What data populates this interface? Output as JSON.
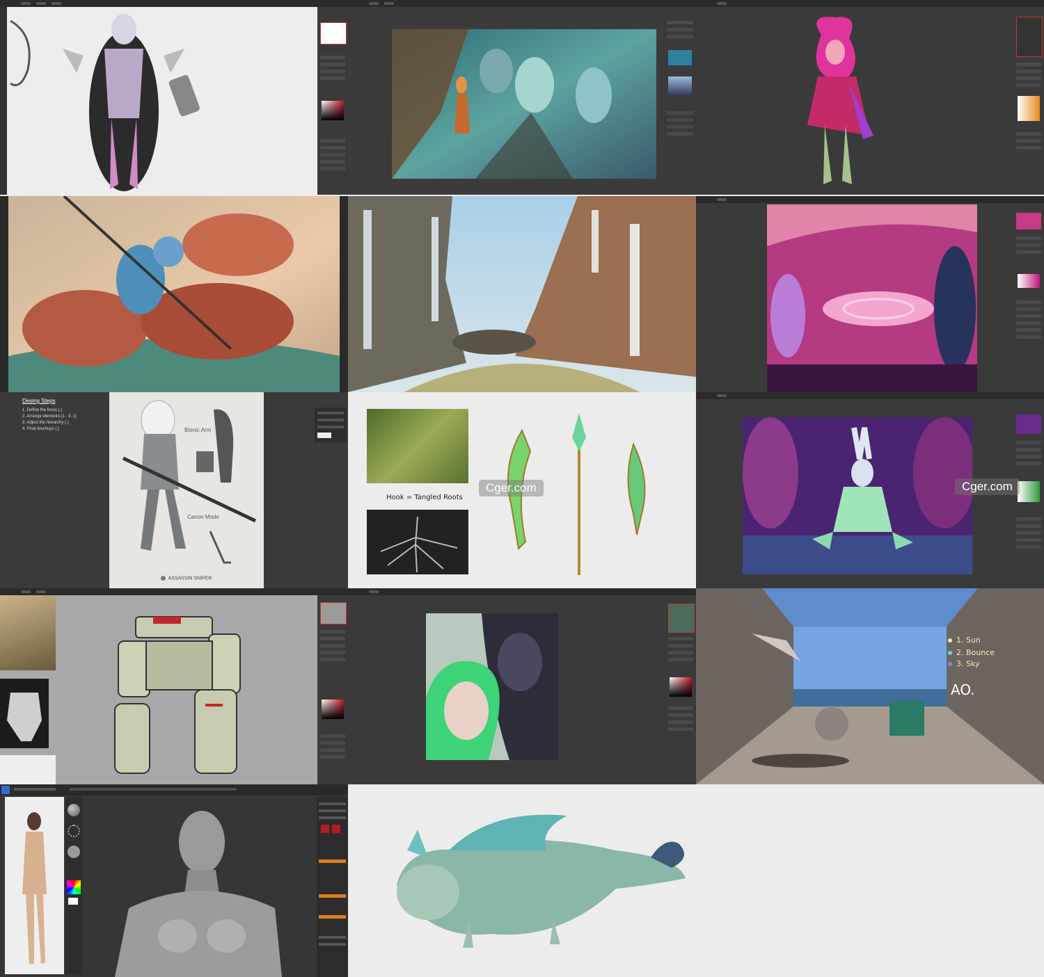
{
  "watermarks": [
    "Cger.com",
    "Cger.com"
  ],
  "tile_design_steps": {
    "title": "Desing Steps",
    "steps": [
      "1. Define the focus (.)",
      "2. Arrange elements (1 - 3, 1)",
      "3. Adjust the hierarchy (.)",
      "4. Final touchups (.)"
    ],
    "labels": [
      "Bionic Arm",
      "Canon Mode"
    ],
    "caption": "ASSASSIN SNIPER"
  },
  "tile_roots": {
    "note": "Hook = Tangled Roots"
  },
  "tile_lighting": {
    "items": [
      "1. Sun",
      "2. Bounce",
      "3. Sky"
    ],
    "footer": "AO.",
    "dot_colors": [
      "#f3e7b5",
      "#6fd6c2",
      "#6f8fd8"
    ]
  },
  "colors": {
    "ps_dark": "#2b2b2b",
    "ps_panel": "#3a3a3a",
    "canvas_light": "#ececec"
  }
}
